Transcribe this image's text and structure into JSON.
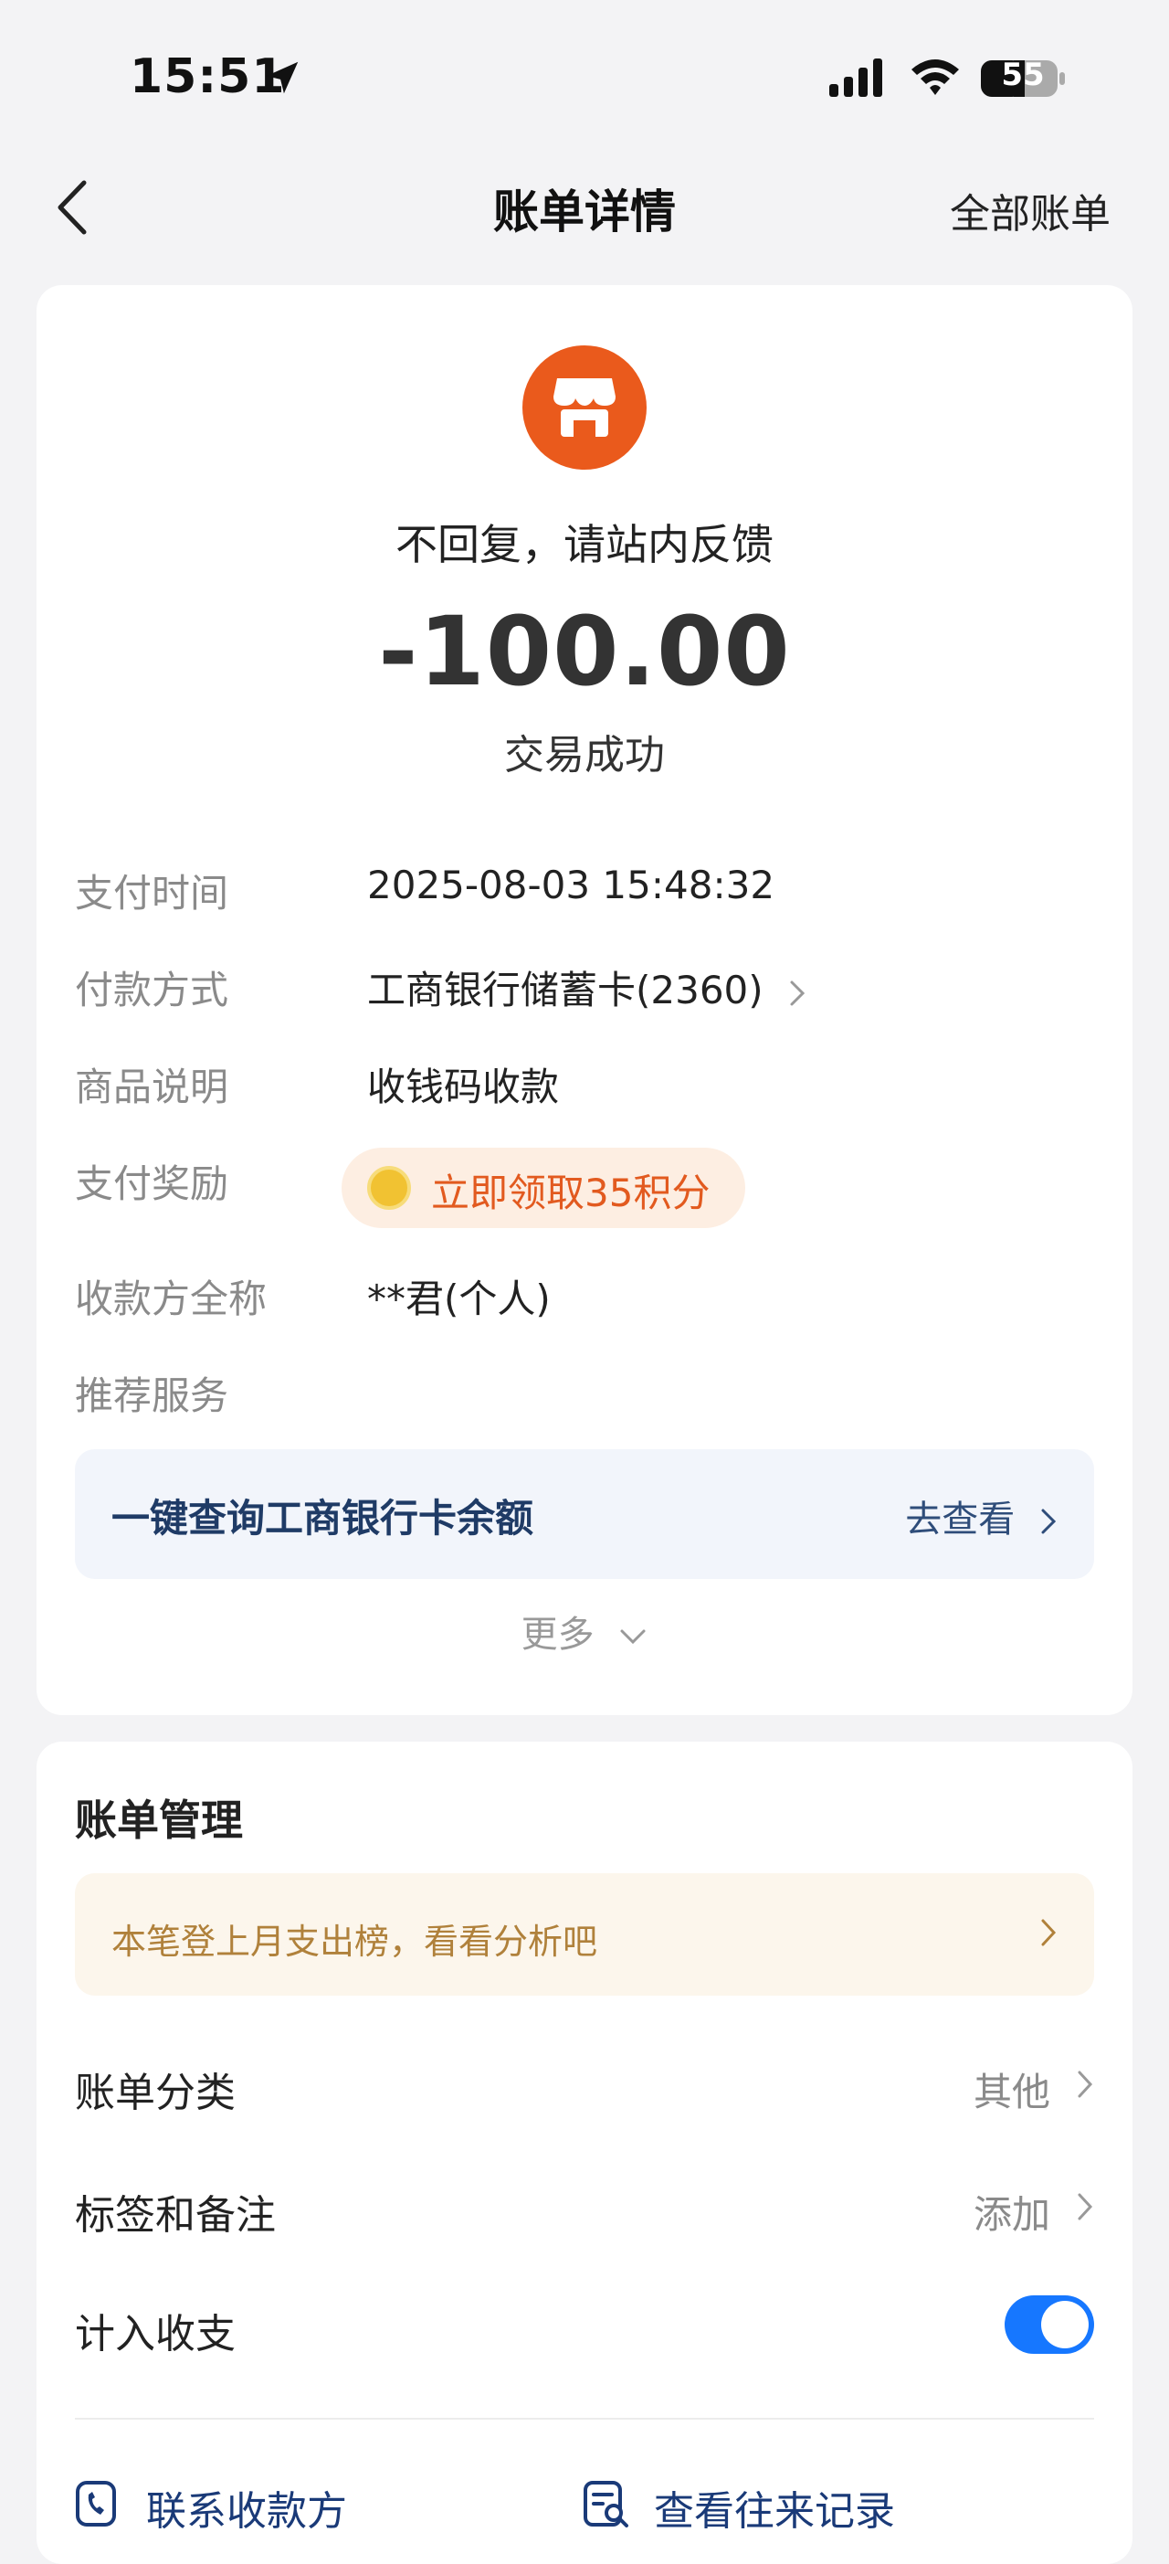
{
  "status_bar": {
    "time": "15:51",
    "battery": "55",
    "icons": [
      "location-arrow-icon",
      "cellular-signal-icon",
      "wifi-icon",
      "battery-icon"
    ]
  },
  "nav": {
    "title": "账单详情",
    "right_link": "全部账单",
    "back_icon": "chevron-left-icon"
  },
  "transaction": {
    "merchant_icon": "store-icon",
    "merchant_name": "不回复，请站内反馈",
    "amount": "-100.00",
    "status": "交易成功",
    "accent_color": "#ea5a1c"
  },
  "details": {
    "pay_time_label": "支付时间",
    "pay_time_value": "2025-08-03 15:48:32",
    "method_label": "付款方式",
    "method_value": "工商银行储蓄卡(2360)",
    "desc_label": "商品说明",
    "desc_value": "收钱码收款",
    "reward_label": "支付奖励",
    "reward_value": "立即领取35积分",
    "payee_label": "收款方全称",
    "payee_value": "**君(个人)",
    "recommend_label": "推荐服务"
  },
  "service": {
    "title": "一键查询工商银行卡余额",
    "action": "去查看"
  },
  "more": "更多",
  "management": {
    "title": "账单管理",
    "banner": "本笔登上月支出榜，看看分析吧",
    "category_label": "账单分类",
    "category_value": "其他",
    "tags_label": "标签和备注",
    "tags_value": "添加",
    "include_label": "计入收支",
    "include_on": true,
    "toggle_color": "#1677ff"
  },
  "actions": {
    "contact": "联系收款方",
    "history": "查看往来记录"
  }
}
